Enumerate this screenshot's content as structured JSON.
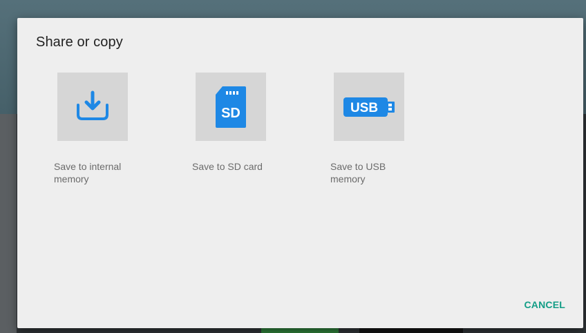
{
  "dialog": {
    "title": "Share or copy",
    "options": [
      {
        "label": "Save to internal memory",
        "icon": "download-icon"
      },
      {
        "label": "Save to SD card",
        "icon": "sd-card-icon",
        "badge": "SD"
      },
      {
        "label": "Save to USB memory",
        "icon": "usb-icon",
        "badge": "USB"
      }
    ],
    "cancel_label": "CANCEL"
  },
  "colors": {
    "accent": "#129d86",
    "icon_blue": "#1e88e5",
    "tile_bg": "#d6d6d6",
    "dialog_bg": "#eeeeee"
  }
}
